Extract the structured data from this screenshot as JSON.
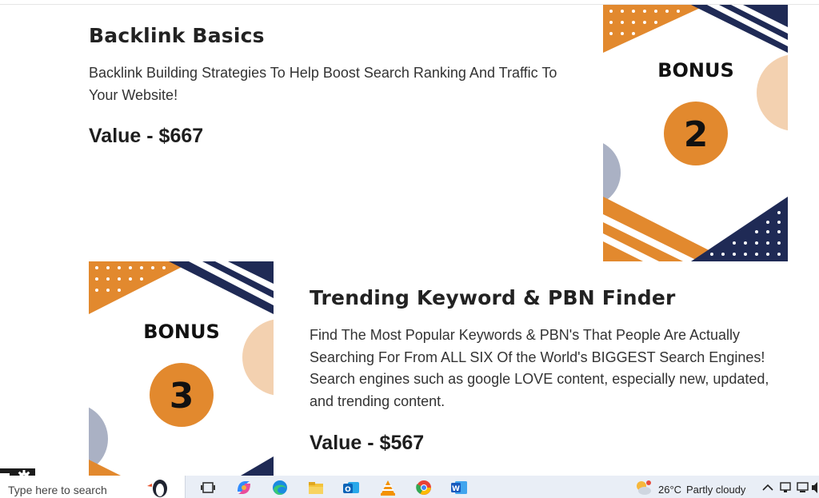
{
  "bonus2": {
    "title": "Backlink Basics",
    "description_lines": [
      "Backlink Building Strategies To Help Boost Search Ranking And Traffic To",
      "Your Website!"
    ],
    "value": "Value - $667",
    "card_label": "BONUS",
    "card_number": "2"
  },
  "bonus3": {
    "title": "Trending Keyword & PBN Finder",
    "description_lines": [
      "Find The Most Popular Keywords & PBN's That People Are Actually",
      "Searching For From ALL SIX Of the World's BIGGEST Search Engines!",
      "Search engines such as google LOVE content, especially new, updated,",
      "and trending content."
    ],
    "value": "Value - $567",
    "card_label": "BONUS",
    "card_number": "3"
  },
  "taskbar": {
    "search_placeholder": "Type here to search",
    "weather_temp": "26°C",
    "weather_desc": "Partly cloudy",
    "icons": [
      "puffin-icon",
      "task-view-icon",
      "copilot-icon",
      "edge-icon",
      "file-explorer-icon",
      "outlook-icon",
      "vlc-icon",
      "chrome-icon",
      "word-icon"
    ]
  },
  "colors": {
    "orange": "#e2892e",
    "navy": "#1f2a55",
    "peach": "#f3d1b0",
    "grey_blue": "#aab1c4"
  }
}
